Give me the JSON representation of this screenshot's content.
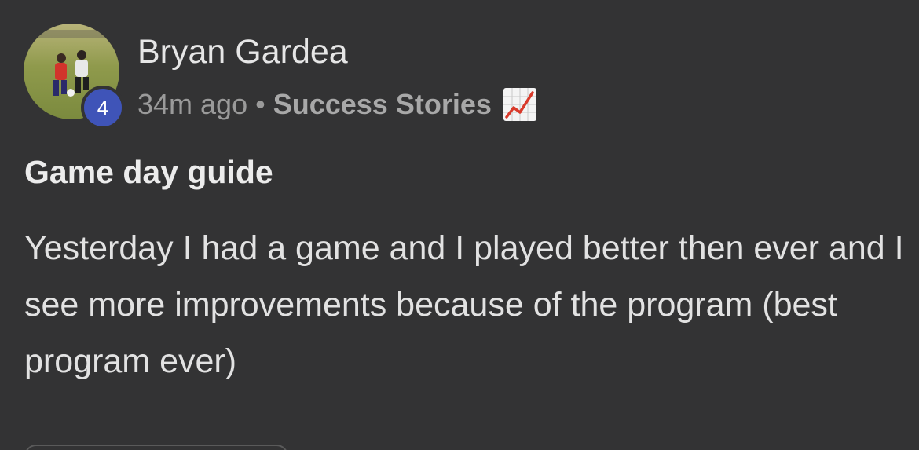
{
  "post": {
    "author": "Bryan Gardea",
    "level": "4",
    "time_ago": "34m ago",
    "separator": "•",
    "category": "Success Stories",
    "category_icon": "chart-increasing-icon",
    "title": "Game day guide",
    "body": "Yesterday I had a game and I played better then ever and I see more improvements because of the program (best program ever)"
  },
  "colors": {
    "background": "#333334",
    "badge": "#3f54b8",
    "chart_line": "#d93a2b"
  }
}
